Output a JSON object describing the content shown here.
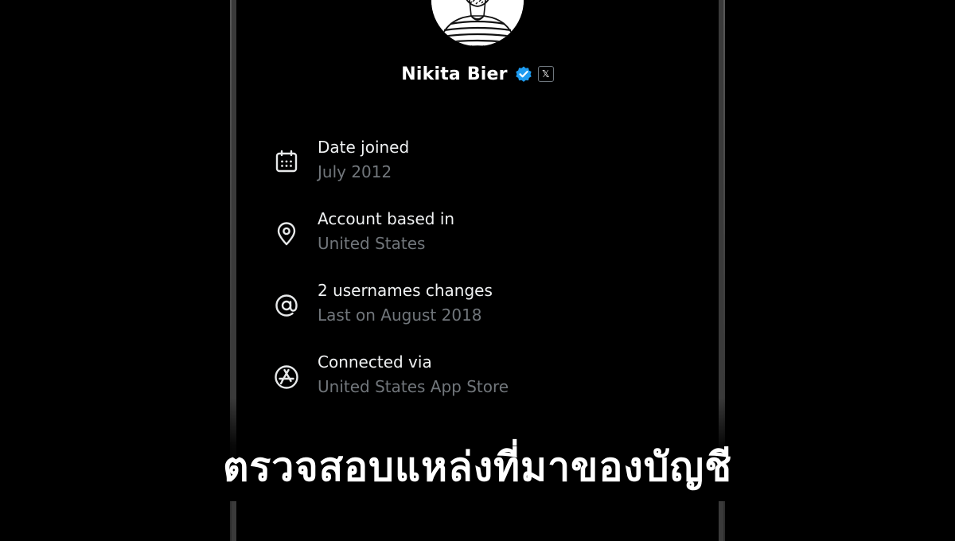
{
  "profile": {
    "name": "Nikita Bier",
    "verified_color": "#1d9bf0",
    "affiliate_badge": "𝕏"
  },
  "info_items": [
    {
      "icon": "calendar-icon",
      "title": "Date joined",
      "subtitle": "July 2012"
    },
    {
      "icon": "location-pin-icon",
      "title": "Account based in",
      "subtitle": "United States"
    },
    {
      "icon": "at-sign-icon",
      "title": "2 usernames changes",
      "subtitle": "Last on August 2018"
    },
    {
      "icon": "app-store-icon",
      "title": "Connected via",
      "subtitle": "United States App Store"
    }
  ],
  "caption": "ตรวจสอบแหล่งที่มาของบัญชี",
  "colors": {
    "background": "#000000",
    "title_text": "#f0f2f3",
    "subtitle_text": "#71767b",
    "frame": "#3a3a3a"
  }
}
